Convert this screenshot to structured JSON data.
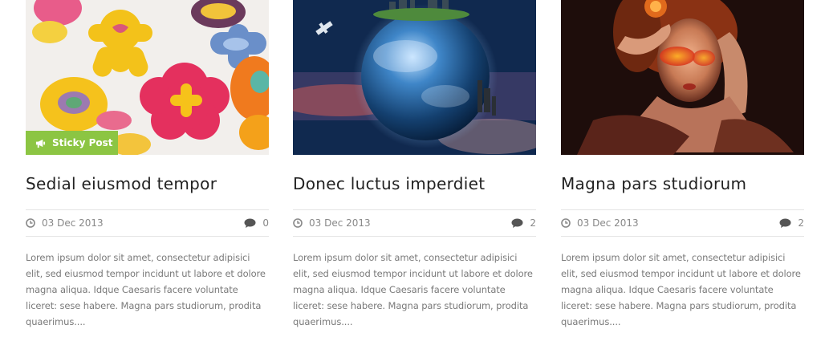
{
  "posts": [
    {
      "image": "cookies-image",
      "badge": "Sticky Post",
      "title": "Sedial eiusmod tempor",
      "date": "03 Dec 2013",
      "comments": "0",
      "excerpt": "Lorem ipsum dolor sit amet, consectetur adipisici elit, sed eiusmod tempor incidunt ut labore et dolore magna aliqua. Idque Caesaris facere voluntate liceret: sese habere. Magna pars studiorum, prodita quaerimus...."
    },
    {
      "image": "earth-image",
      "title": "Donec luctus imperdiet",
      "date": "03 Dec 2013",
      "comments": "2",
      "excerpt": "Lorem ipsum dolor sit amet, consectetur adipisici elit, sed eiusmod tempor incidunt ut labore et dolore magna aliqua. Idque Caesaris facere voluntate liceret: sese habere. Magna pars studiorum, prodita quaerimus...."
    },
    {
      "image": "portrait-image",
      "title": "Magna pars studiorum",
      "date": "03 Dec 2013",
      "comments": "2",
      "excerpt": "Lorem ipsum dolor sit amet, consectetur adipisici elit, sed eiusmod tempor incidunt ut labore et dolore magna aliqua. Idque Caesaris facere voluntate liceret: sese habere. Magna pars studiorum, prodita quaerimus...."
    }
  ],
  "colors": {
    "badge": "#8cc543",
    "title": "#222222",
    "meta": "#888888",
    "divider": "#e4e4e4"
  },
  "icons": {
    "badge": "megaphone-icon",
    "date": "clock-icon",
    "comments": "comment-bubble-icon"
  }
}
